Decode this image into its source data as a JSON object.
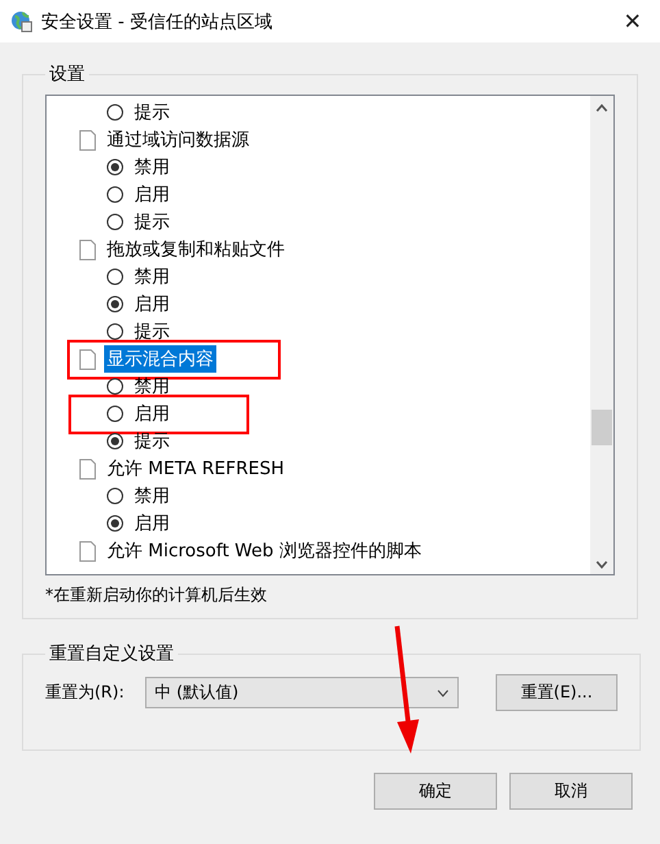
{
  "window": {
    "title": "安全设置 - 受信任的站点区域",
    "close": "✕"
  },
  "settings": {
    "legend": "设置",
    "rows": [
      {
        "kind": "radio",
        "label": "提示",
        "selected": false,
        "annotated": false
      },
      {
        "kind": "setting",
        "label": "通过域访问数据源",
        "selected": false,
        "annotated": false
      },
      {
        "kind": "radio",
        "label": "禁用",
        "selected": true,
        "annotated": false
      },
      {
        "kind": "radio",
        "label": "启用",
        "selected": false,
        "annotated": false
      },
      {
        "kind": "radio",
        "label": "提示",
        "selected": false,
        "annotated": false
      },
      {
        "kind": "setting",
        "label": "拖放或复制和粘贴文件",
        "selected": false,
        "annotated": false
      },
      {
        "kind": "radio",
        "label": "禁用",
        "selected": false,
        "annotated": false
      },
      {
        "kind": "radio",
        "label": "启用",
        "selected": true,
        "annotated": false
      },
      {
        "kind": "radio",
        "label": "提示",
        "selected": false,
        "annotated": false
      },
      {
        "kind": "setting",
        "label": "显示混合内容",
        "selected": true,
        "annotated": true
      },
      {
        "kind": "radio",
        "label": "禁用",
        "selected": false,
        "annotated": false
      },
      {
        "kind": "radio",
        "label": "启用",
        "selected": false,
        "annotated": true
      },
      {
        "kind": "radio",
        "label": "提示",
        "selected": true,
        "annotated": false
      },
      {
        "kind": "setting",
        "label": "允许 META REFRESH",
        "selected": false,
        "annotated": false
      },
      {
        "kind": "radio",
        "label": "禁用",
        "selected": false,
        "annotated": false
      },
      {
        "kind": "radio",
        "label": "启用",
        "selected": true,
        "annotated": false
      },
      {
        "kind": "setting",
        "label": "允许 Microsoft Web 浏览器控件的脚本",
        "selected": false,
        "annotated": false
      }
    ],
    "note": "*在重新启动你的计算机后生效"
  },
  "reset": {
    "legend": "重置自定义设置",
    "label": "重置为(R):",
    "value": "中 (默认值)",
    "button": "重置(E)..."
  },
  "annotation_arrow": true,
  "buttons": [
    "确定",
    "取消"
  ]
}
